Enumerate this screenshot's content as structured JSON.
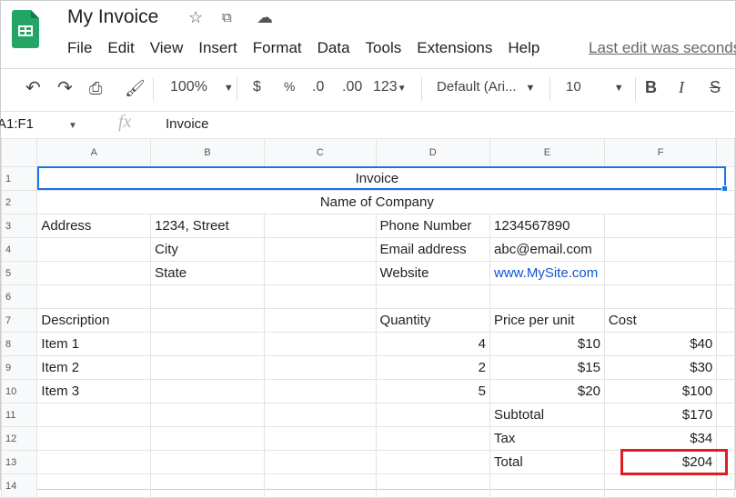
{
  "app": {
    "title": "My Invoice",
    "last_edit": "Last edit was seconds ago"
  },
  "icons": {
    "logo": "sheets-logo",
    "star": "star-icon",
    "move": "move-to-folder-icon",
    "cloud": "cloud-saved-icon"
  },
  "menu": [
    "File",
    "Edit",
    "View",
    "Insert",
    "Format",
    "Data",
    "Tools",
    "Extensions",
    "Help"
  ],
  "toolbar": {
    "zoom": "100%",
    "currency": "$",
    "percent": "%",
    "dec_less": ".0",
    "dec_more": ".00",
    "format": "123",
    "font": "Default (Ari...",
    "size": "10",
    "bold": "B",
    "italic": "I",
    "strike": "S"
  },
  "formula": {
    "namebox": "A1:F1",
    "fx": "fx",
    "value": "Invoice"
  },
  "columns": [
    "A",
    "B",
    "C",
    "D",
    "E",
    "F"
  ],
  "rows": [
    {
      "n": "1",
      "title": "Invoice"
    },
    {
      "n": "2",
      "title": "Name of Company"
    },
    {
      "n": "3",
      "cells": [
        "Address",
        "1234, Street",
        "",
        "Phone Number",
        "1234567890",
        ""
      ]
    },
    {
      "n": "4",
      "cells": [
        "",
        "City",
        "",
        "Email address",
        "abc@email.com",
        ""
      ]
    },
    {
      "n": "5",
      "cells": [
        "",
        "State",
        "",
        "Website",
        "www.MySite.com",
        ""
      ]
    },
    {
      "n": "6",
      "cells": [
        "",
        "",
        "",
        "",
        "",
        ""
      ]
    },
    {
      "n": "7",
      "cells": [
        "Description",
        "",
        "",
        "Quantity",
        "Price per unit",
        "Cost"
      ]
    },
    {
      "n": "8",
      "cells": [
        "Item 1",
        "",
        "",
        "4",
        "$10",
        "$40"
      ]
    },
    {
      "n": "9",
      "cells": [
        "Item 2",
        "",
        "",
        "2",
        "$15",
        "$30"
      ]
    },
    {
      "n": "10",
      "cells": [
        "Item 3",
        "",
        "",
        "5",
        "$20",
        "$100"
      ]
    },
    {
      "n": "11",
      "cells": [
        "",
        "",
        "",
        "",
        "Subtotal",
        "$170"
      ]
    },
    {
      "n": "12",
      "cells": [
        "",
        "",
        "",
        "",
        "Tax",
        "$34"
      ]
    },
    {
      "n": "13",
      "cells": [
        "",
        "",
        "",
        "",
        "Total",
        "$204"
      ]
    },
    {
      "n": "14",
      "cells": [
        "",
        "",
        "",
        "",
        "",
        ""
      ]
    }
  ],
  "highlight_color": "#e01b24",
  "selection_color": "#1a73e8"
}
